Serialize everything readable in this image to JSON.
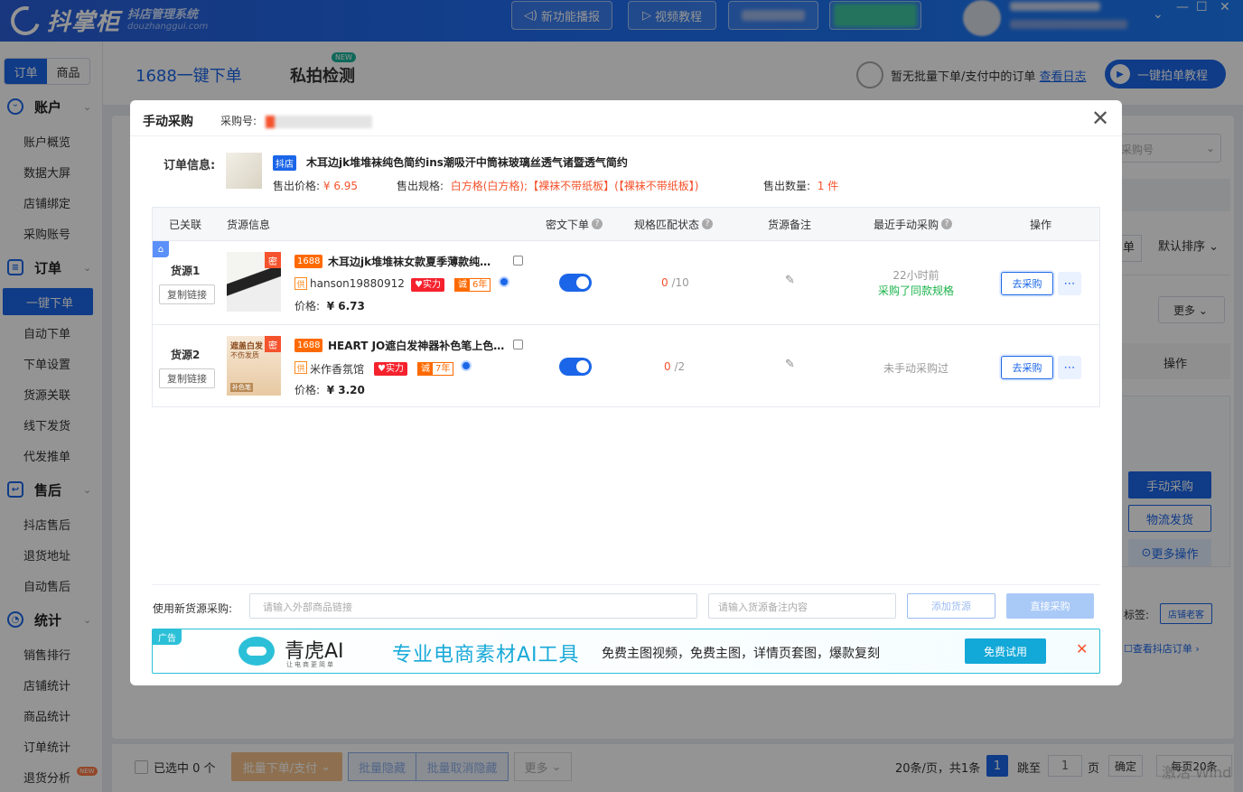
{
  "app": {
    "logo_text": "抖掌柜",
    "logo_sub1": "抖店管理系统",
    "logo_sub2": "douzhanggui.com",
    "top_buttons": [
      "新功能播报",
      "视频教程"
    ],
    "window_controls": [
      "⌄",
      "—",
      "☐",
      "✕"
    ]
  },
  "sidebar": {
    "tabs": [
      "订单",
      "商品"
    ],
    "groups": [
      {
        "label": "账户",
        "icon": "smile-icon",
        "items": [
          "账户概览",
          "数据大屏",
          "店铺绑定",
          "采购账号"
        ]
      },
      {
        "label": "订单",
        "icon": "list-icon",
        "items": [
          "一键下单",
          "自动下单",
          "下单设置",
          "货源关联",
          "线下发货",
          "代发推单"
        ]
      },
      {
        "label": "售后",
        "icon": "return-icon",
        "items": [
          "抖店售后",
          "退货地址",
          "自动售后"
        ]
      },
      {
        "label": "统计",
        "icon": "pie-icon",
        "items": [
          "销售排行",
          "店铺统计",
          "商品统计",
          "订单统计",
          "退货分析"
        ]
      }
    ],
    "active_item": "一键下单",
    "new_badge": "NEW"
  },
  "header": {
    "tab1": "1688一键下单",
    "tab2": "私拍检测",
    "tab2_badge": "NEW",
    "info": "暂无批量下单/支付中的订单",
    "info_link": "查看日志",
    "tutorial": "一键拍单教程"
  },
  "background": {
    "select_placeholder": "采购号",
    "tab_fragment": "单",
    "sort": "默认排序",
    "more": "更多",
    "op_header": "操作",
    "btn_manual": "手动采购",
    "btn_logistics": "物流发货",
    "btn_more_ops": "更多操作",
    "tag_label": "标签:",
    "tag_value": "店铺老客",
    "view_order": "查看抖店订单"
  },
  "bottom_bar": {
    "selected": "已选中 0 个",
    "batch_pay": "批量下单/支付",
    "batch_hide": "批量隐藏",
    "batch_unhide": "批量取消隐藏",
    "more": "更多",
    "pager_info": "20条/页，共1条",
    "page": "1",
    "jump_label": "跳至",
    "jump_value": "1",
    "page_unit": "页",
    "confirm": "确定",
    "per_page": "每页20条"
  },
  "watermark": "激活 Wind",
  "modal": {
    "title": "手动采购",
    "po_label": "采购号:",
    "order_info_label": "订单信息:",
    "platform_tag": "抖店",
    "product_name": "木耳边jk堆堆袜纯色简约ins潮吸汗中筒袜玻璃丝透气诸暨透气简约",
    "sell_price_label": "售出价格:",
    "sell_price": "¥ 6.95",
    "sell_spec_label": "售出规格:",
    "sell_spec": "白方格(白方格);【裸袜不带纸板】(【裸袜不带纸板】)",
    "sell_qty_label": "售出数量:",
    "sell_qty": "1 件",
    "table_headers": [
      "已关联",
      "货源信息",
      "密文下单",
      "规格匹配状态",
      "货源备注",
      "最近手动采购",
      "操作"
    ],
    "rows": [
      {
        "label": "货源1",
        "copy": "复制链接",
        "tag": "1688",
        "name": "木耳边jk堆堆袜女款夏季薄款纯…",
        "shop": "hanson19880912",
        "badge_strong": "实力",
        "badge_cheng": "诚",
        "badge_years": "6年",
        "price_label": "价格:",
        "price": "¥ 6.73",
        "match_num": "0",
        "match_total": "/10",
        "recent_time": "22小时前",
        "recent_note": "采购了同款规格",
        "action": "去采购",
        "secret": "密"
      },
      {
        "label": "货源2",
        "copy": "复制链接",
        "tag": "1688",
        "name": "HEART JO遮白发神器补色笔上色…",
        "shop": "米作香氛馆",
        "badge_strong": "实力",
        "badge_cheng": "诚",
        "badge_years": "7年",
        "price_label": "价格:",
        "price": "¥ 3.20",
        "match_num": "0",
        "match_total": "/2",
        "recent_time": "",
        "recent_note": "未手动采购过",
        "action": "去采购",
        "secret": "密",
        "thumb_text1": "遮盖白发",
        "thumb_text2": "不伤发质",
        "thumb_text3": "补色笔"
      }
    ],
    "new_source_label": "使用新货源采购:",
    "link_placeholder": "请输入外部商品链接",
    "note_placeholder": "请输入货源备注内容",
    "add_source": "添加货源",
    "direct_buy": "直接采购",
    "ad": {
      "tag": "广告",
      "brand": "青虎AI",
      "brand_sub": "让电商更简单",
      "headline": "专业电商素材AI工具",
      "desc": "免费主图视频，免费主图，详情页套图，爆款复刻",
      "cta": "免费试用"
    }
  }
}
